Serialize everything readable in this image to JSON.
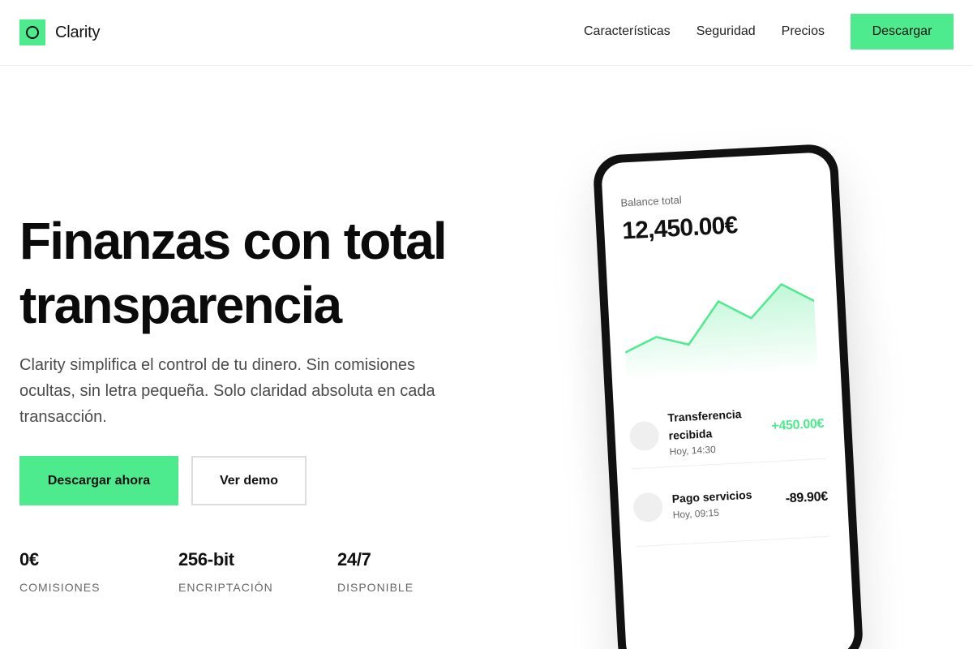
{
  "app": {
    "name": "Clarity"
  },
  "colors": {
    "accent": "#4eea8e",
    "text": "#111111",
    "muted": "#4b4b4b",
    "positive": "#4eea8e"
  },
  "nav": {
    "links": [
      "Características",
      "Seguridad",
      "Precios"
    ],
    "cta": "Descargar"
  },
  "hero": {
    "title_line1": "Finanzas con total",
    "title_line2": "transparencia",
    "subtitle": "Clarity simplifica el control de tu dinero. Sin comisiones ocultas, sin letra pequeña. Solo claridad absoluta en cada transacción.",
    "primary_button": "Descargar ahora",
    "secondary_button": "Ver demo"
  },
  "stats": [
    {
      "value": "0€",
      "label": "COMISIONES"
    },
    {
      "value": "256-bit",
      "label": "ENCRIPTACIÓN"
    },
    {
      "value": "24/7",
      "label": "DISPONIBLE"
    }
  ],
  "phone": {
    "balance_label": "Balance total",
    "balance_value": "12,450.00€",
    "chart_trend": [
      2,
      5,
      3,
      12,
      8,
      15,
      11
    ],
    "transactions": [
      {
        "name": "Transferencia recibida",
        "time": "Hoy, 14:30",
        "amount": "+450.00€",
        "type": "positive"
      },
      {
        "name": "Pago servicios",
        "time": "Hoy, 09:15",
        "amount": "-89.90€",
        "type": "negative"
      }
    ]
  }
}
